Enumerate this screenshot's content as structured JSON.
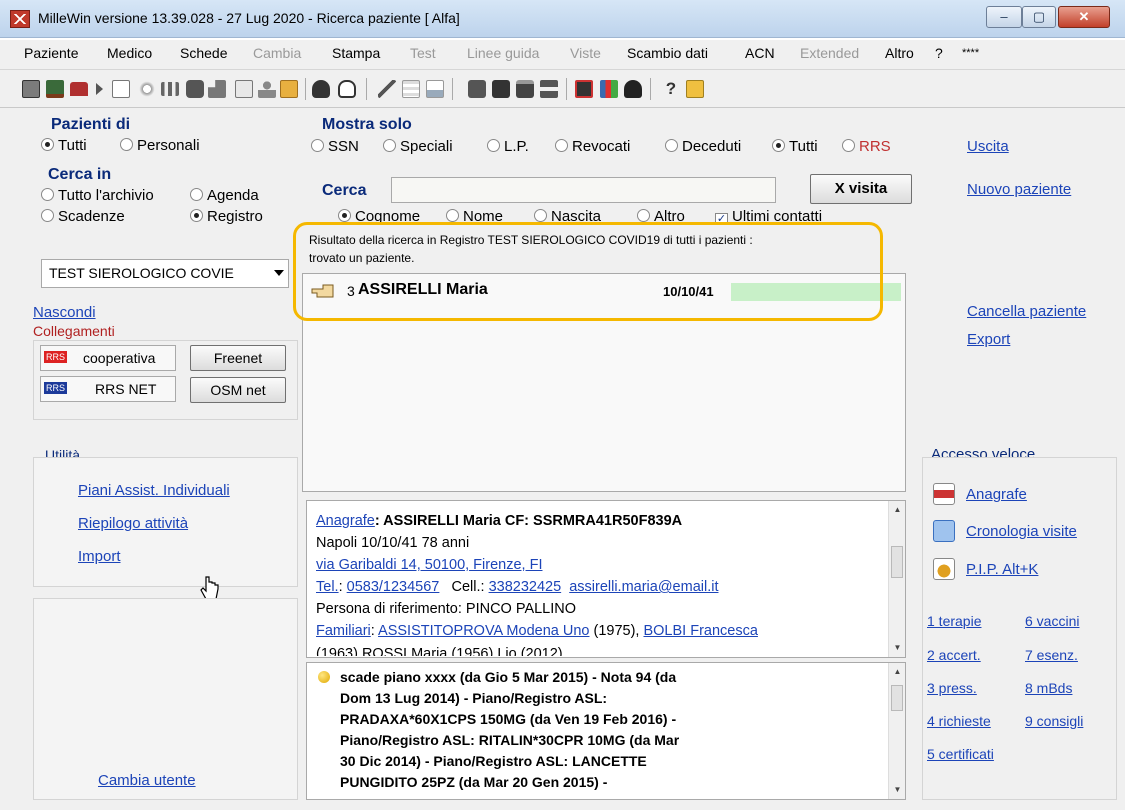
{
  "window": {
    "title": "MilleWin versione 13.39.028 - 27 Lug 2020 - Ricerca paziente [ Alfa]",
    "buttons": [
      "–",
      "▢",
      "✕"
    ]
  },
  "menubar": [
    {
      "label": "Paziente",
      "enabled": true
    },
    {
      "label": "Medico",
      "enabled": true
    },
    {
      "label": "Schede",
      "enabled": true
    },
    {
      "label": "Cambia",
      "enabled": false
    },
    {
      "label": "Stampa",
      "enabled": true
    },
    {
      "label": "Test",
      "enabled": false
    },
    {
      "label": "Linee guida",
      "enabled": false
    },
    {
      "label": "Viste",
      "enabled": false
    },
    {
      "label": "Scambio dati",
      "enabled": true
    },
    {
      "label": "ACN",
      "enabled": true
    },
    {
      "label": "Extended",
      "enabled": false
    },
    {
      "label": "Altro",
      "enabled": true
    },
    {
      "label": "?",
      "enabled": true
    },
    {
      "label": "****",
      "enabled": true
    }
  ],
  "toolbar_icons": [
    "calculator-icon",
    "bank-icon",
    "stamp-icon",
    "arrow-right-icon",
    "list-icon",
    "lamp-icon",
    "people-icon",
    "bottle-icon",
    "chart-icon",
    "window-icon",
    "person-icon",
    "family-icon",
    "bottle2-icon",
    "hand-icon",
    "pen-icon",
    "grid-icon",
    "image-icon",
    "printer1-icon",
    "printer2-icon",
    "printer3-icon",
    "printer4-icon",
    "database-icon",
    "chart2-icon",
    "phone-icon",
    "help-icon",
    "book-icon"
  ],
  "left": {
    "pazienti_di": {
      "header": "Pazienti di",
      "options": [
        "Tutti",
        "Personali"
      ],
      "selected": "Tutti"
    },
    "cerca_in": {
      "header": "Cerca in",
      "options": [
        "Tutto l'archivio",
        "Agenda",
        "Scadenze",
        "Registro"
      ],
      "selected": "Registro"
    },
    "registro_value": "TEST SIEROLOGICO COVIE",
    "nascondi": "Nascondi",
    "collegamenti": {
      "label": "Collegamenti",
      "items": [
        {
          "badge": "RRS",
          "label": "cooperativa"
        },
        {
          "badge": "RRS",
          "label": "RRS NET"
        }
      ],
      "buttons": [
        "Freenet",
        "OSM net"
      ]
    },
    "utilita": {
      "label": "Utilità",
      "links": [
        "Piani Assist. Individuali",
        "Riepilogo attività",
        "Import"
      ]
    },
    "cambia_utente": "Cambia utente"
  },
  "center": {
    "mostra_solo": {
      "header": "Mostra solo",
      "options": [
        "SSN",
        "Speciali",
        "L.P.",
        "Revocati",
        "Deceduti",
        "Tutti",
        "RRS"
      ],
      "selected": "Tutti"
    },
    "cerca": {
      "label": "Cerca",
      "value": "",
      "button": "X visita"
    },
    "search_by": {
      "options": [
        "Cognome",
        "Nome",
        "Nascita",
        "Altro"
      ],
      "selected": "Cognome",
      "checkbox_label": "Ultimi contatti",
      "checked": true
    },
    "result_text_1": "Risultato della ricerca in Registro TEST SIEROLOGICO COVID19 di tutti i pazienti  :",
    "result_text_2": "trovato un paziente.",
    "results": [
      {
        "num": "3",
        "name": "ASSIRELLI Maria",
        "dob": "10/10/41"
      }
    ],
    "detail": {
      "anagrafe_label": "Anagrafe",
      "name_cf": ": ASSIRELLI Maria CF: SSRMRA41R50F839A",
      "birth": "Napoli 10/10/41 78 anni",
      "address": "via Garibaldi 14, 50100, Firenze, FI",
      "tel_label": "Tel.",
      "tel": "0583/1234567",
      "cell_label": "Cell.",
      "cell": "338232425",
      "email": "assirelli.maria@email.it",
      "riferimento": "Persona di riferimento: PINCO PALLINO",
      "familiari_label": "Familiari",
      "familiari_1": "ASSISTITOPROVA Modena Uno",
      "familiari_1_year": " (1975), ",
      "familiari_2": "BOLBI Francesca",
      "familiari_cut": "(1963) ROSSI Maria (1956) Lio (2012)"
    },
    "reminders": [
      "scade piano xxxx (da Gio 5 Mar 2015)  - Nota 94 (da",
      "Dom 13 Lug 2014)  - Piano/Registro ASL:",
      "PRADAXA*60X1CPS 150MG (da Ven 19 Feb 2016)  -",
      "Piano/Registro ASL: RITALIN*30CPR 10MG (da Mar",
      "30 Dic 2014)  - Piano/Registro ASL: LANCETTE",
      "PUNGIDITO 25PZ (da Mar 20 Gen 2015)  -"
    ]
  },
  "right": {
    "top_links": [
      "Uscita",
      "Nuovo paziente"
    ],
    "mid_links": [
      "Cancella paziente",
      "Export"
    ],
    "accesso_veloce": {
      "label": "Accesso veloce",
      "items": [
        "Anagrafe",
        "Cronologia visite",
        "P.I.P. Alt+K"
      ]
    },
    "shortcuts": [
      [
        "1 terapie",
        "6 vaccini"
      ],
      [
        "2 accert.",
        "7 esenz."
      ],
      [
        "3 press.",
        "8 mBds"
      ],
      [
        "4 richieste",
        "9 consigli"
      ],
      [
        "5 certificati",
        ""
      ]
    ]
  },
  "colors": {
    "accent_link": "#1c44b8",
    "header": "#0a2a7a",
    "highlight": "#f5b800",
    "progress": "#c8f0c8"
  }
}
